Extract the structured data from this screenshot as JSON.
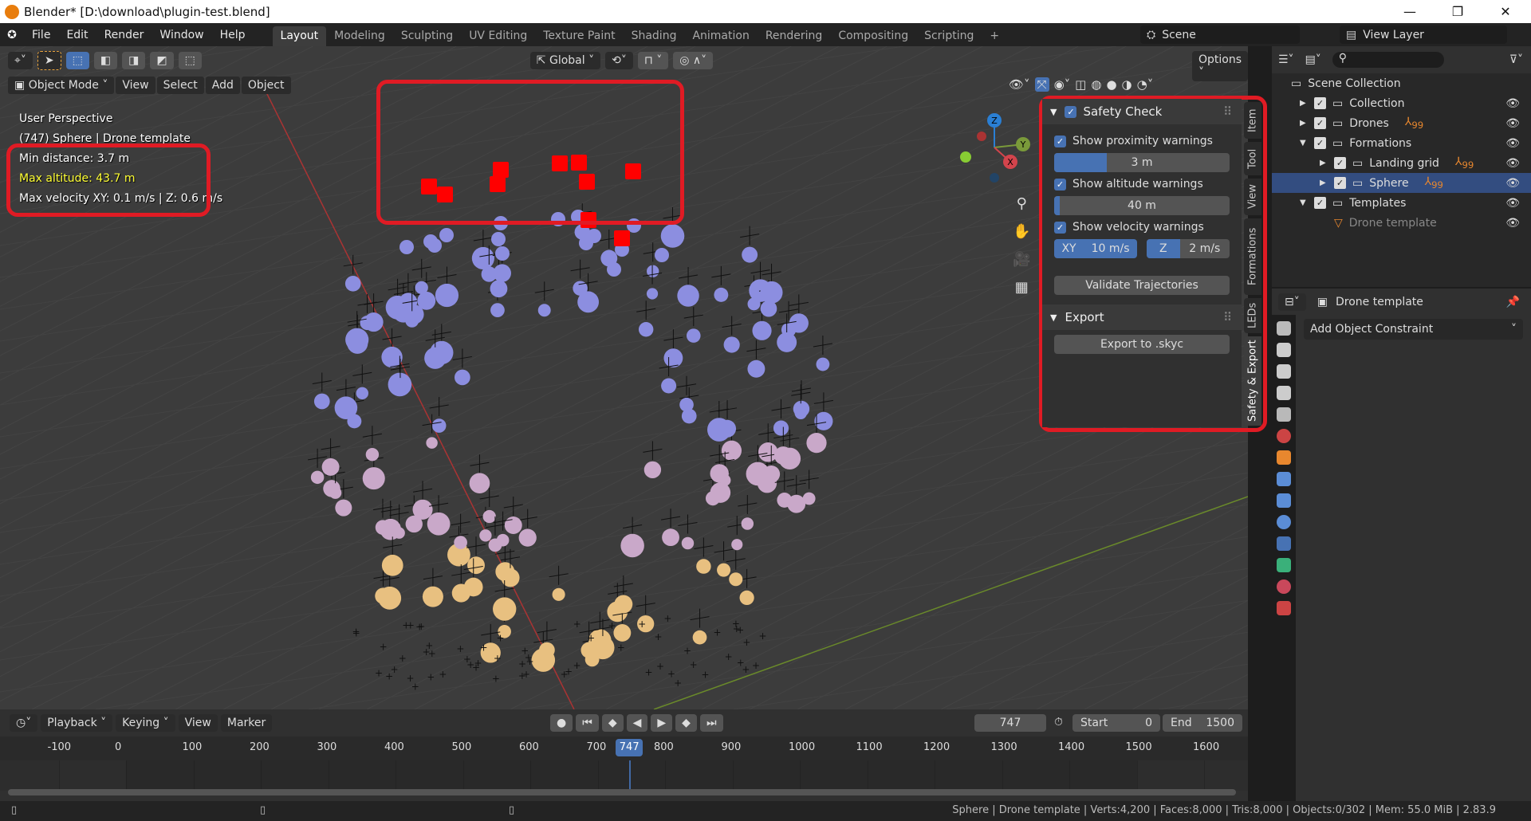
{
  "window": {
    "title": "Blender* [D:\\download\\plugin-test.blend]",
    "controls": [
      "—",
      "❐",
      "✕"
    ]
  },
  "menubar": {
    "items": [
      "File",
      "Edit",
      "Render",
      "Window",
      "Help"
    ],
    "workspaces": [
      "Layout",
      "Modeling",
      "Sculpting",
      "UV Editing",
      "Texture Paint",
      "Shading",
      "Animation",
      "Rendering",
      "Compositing",
      "Scripting"
    ],
    "active_workspace": "Layout",
    "add": "+",
    "scene": "Scene",
    "view_layer": "View Layer"
  },
  "toolbar": {
    "orientation": "Global",
    "options": "Options"
  },
  "viewport_header": {
    "mode": "Object Mode",
    "menus": [
      "View",
      "Select",
      "Add",
      "Object"
    ]
  },
  "viewport_overlay": {
    "perspective": "User Perspective",
    "object": "(747) Sphere | Drone template",
    "min_distance": "Min distance: 3.7 m",
    "max_altitude": "Max altitude: 43.7 m",
    "max_velocity": "Max velocity XY: 0.1 m/s | Z: 0.6 m/s",
    "warning_color": "#ffff33"
  },
  "gizmo": {
    "x": "X",
    "y": "Y",
    "z": "Z"
  },
  "npanel": {
    "safety": {
      "title": "Safety Check",
      "enabled": true,
      "proximity": {
        "label": "Show proximity warnings",
        "checked": true,
        "value": "3 m",
        "fill_fraction": 0.3
      },
      "altitude": {
        "label": "Show altitude warnings",
        "checked": true,
        "value": "40 m",
        "fill_fraction": 0.03
      },
      "velocity": {
        "label": "Show velocity warnings",
        "checked": true,
        "xy_label": "XY",
        "xy_value": "10 m/s",
        "z_label": "Z",
        "z_value": "2 m/s"
      },
      "validate": "Validate Trajectories"
    },
    "export": {
      "title": "Export",
      "button": "Export to .skyc"
    },
    "tabs": [
      "Item",
      "Tool",
      "View",
      "Formations",
      "LEDs",
      "Safety & Export"
    ],
    "active_tab": "Safety & Export"
  },
  "outliner": {
    "root": "Scene Collection",
    "rows": [
      {
        "name": "Collection",
        "level": 1,
        "expanded": false
      },
      {
        "name": "Drones",
        "level": 1,
        "expanded": false,
        "badge": "99"
      },
      {
        "name": "Formations",
        "level": 1,
        "expanded": true
      },
      {
        "name": "Landing grid",
        "level": 2,
        "expanded": false,
        "badge": "99"
      },
      {
        "name": "Sphere",
        "level": 2,
        "expanded": false,
        "badge": "99",
        "selected": true
      },
      {
        "name": "Templates",
        "level": 1,
        "expanded": true
      },
      {
        "name": "Drone template",
        "level": 2,
        "dimmed": true
      }
    ]
  },
  "properties": {
    "object": "Drone template",
    "add_constraint": "Add Object Constraint"
  },
  "timeline": {
    "menus": [
      "Playback",
      "Keying",
      "View",
      "Marker"
    ],
    "current_frame": "747",
    "start_label": "Start",
    "start": "0",
    "end_label": "End",
    "end": "1500",
    "ticks": [
      "-100",
      "0",
      "100",
      "200",
      "300",
      "400",
      "500",
      "600",
      "700",
      "800",
      "900",
      "1000",
      "1100",
      "1200",
      "1300",
      "1400",
      "1500",
      "1600"
    ]
  },
  "statusbar": {
    "text": "Sphere | Drone template | Verts:4,200 | Faces:8,000 | Tris:8,000 | Objects:0/302 | Mem: 55.0 MiB | 2.83.9"
  },
  "colors": {
    "accent": "#4772b3",
    "highlight": "#e01b24",
    "selected_row": "#334d80"
  }
}
